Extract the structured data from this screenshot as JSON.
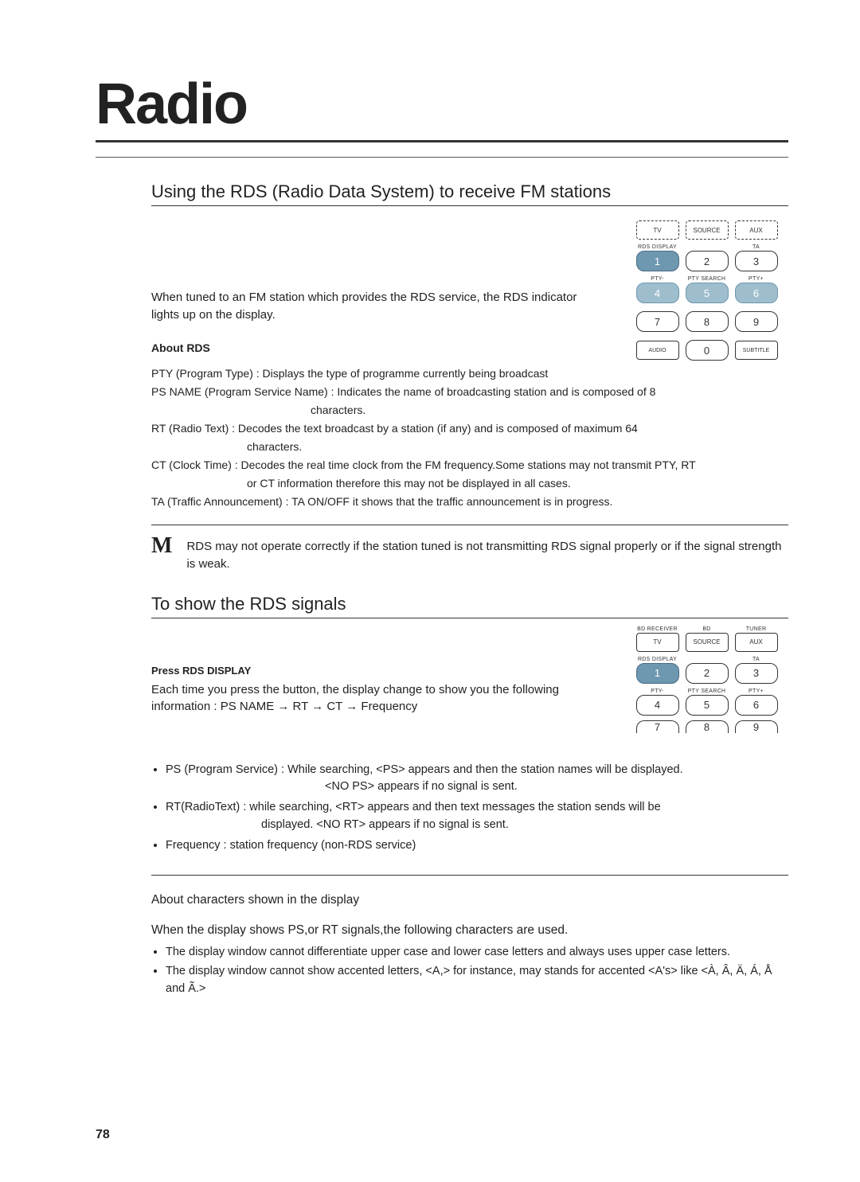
{
  "title": "Radio",
  "section1": {
    "heading": "Using the RDS (Radio Data System) to receive FM stations",
    "placeholder": " ",
    "when_tuned": "When tuned to an FM station which provides the RDS service, the RDS indicator lights up on the display.",
    "about_label": "About RDS",
    "defs": {
      "pty": "PTY (Program Type) : Displays the type of programme currently being broadcast",
      "ps1": "PS NAME (Program Service Name) : Indicates the name of broadcasting station and is composed of 8",
      "ps2": "characters.",
      "rt1": "RT (Radio Text) : Decodes the text broadcast by a station (if any) and is composed of maximum 64",
      "rt2": "characters.",
      "ct1": "CT (Clock Time) : Decodes the real time clock from the FM frequency.Some stations may not transmit PTY, RT",
      "ct2": "or CT information therefore this may not be displayed in all cases.",
      "ta": "TA (Traffic Announcement) : TA ON/OFF it shows that the traffic announcement is in progress."
    },
    "note_icon": "M",
    "note_text": "RDS may not operate correctly if the station tuned is not transmitting RDS signal properly or if the signal strength is weak."
  },
  "section2": {
    "heading": "To show the RDS signals",
    "placeholder": " ",
    "press_label": "Press RDS DISPLAY",
    "each_time": "Each time you press the button, the display change to show you the following information : PS NAME → RT → CT → Frequency",
    "bullets": {
      "ps1": "PS (Program Service) : While searching, <PS> appears and then the station names will be displayed.",
      "ps2": "<NO PS> appears if no signal is sent.",
      "rt1": "RT(RadioText) : while searching, <RT> appears and then text messages the station sends will be",
      "rt2": "displayed. <NO RT> appears if no signal is sent.",
      "freq": "Frequency : station frequency (non-RDS service)"
    }
  },
  "section3": {
    "about_chars": "About characters shown in the display",
    "when_display": "When the display shows PS,or RT signals,the following characters are used.",
    "b1": "The display window cannot differentiate upper case and lower case letters and always uses upper case letters.",
    "b2": "The display window cannot show accented letters, <A,> for instance, may stands for accented <A's> like <À, Â, Ä, Á, Å and Ã.>"
  },
  "remote1": {
    "row_top_labels": [
      "",
      "",
      ""
    ],
    "row_top": [
      "TV",
      "SOURCE",
      "AUX"
    ],
    "row_mid_labels": [
      "RDS DISPLAY",
      "",
      "TA"
    ],
    "nums1": [
      "1",
      "2",
      "3"
    ],
    "row_pty_labels": [
      "PTY-",
      "PTY SEARCH",
      "PTY+"
    ],
    "nums2": [
      "4",
      "5",
      "6"
    ],
    "nums3": [
      "7",
      "8",
      "9"
    ],
    "row_bottom": [
      "AUDIO",
      "0",
      "SUBTITLE"
    ]
  },
  "remote2": {
    "row_top_labels": [
      "BD RECEIVER",
      "BD",
      "TUNER"
    ],
    "row_top": [
      "TV",
      "SOURCE",
      "AUX"
    ],
    "row_mid_labels": [
      "RDS DISPLAY",
      "",
      "TA"
    ],
    "nums1": [
      "1",
      "2",
      "3"
    ],
    "row_pty_labels": [
      "PTY-",
      "PTY SEARCH",
      "PTY+"
    ],
    "nums2": [
      "4",
      "5",
      "6"
    ],
    "nums3": [
      "7",
      "8",
      "9"
    ]
  },
  "page_number": "78"
}
